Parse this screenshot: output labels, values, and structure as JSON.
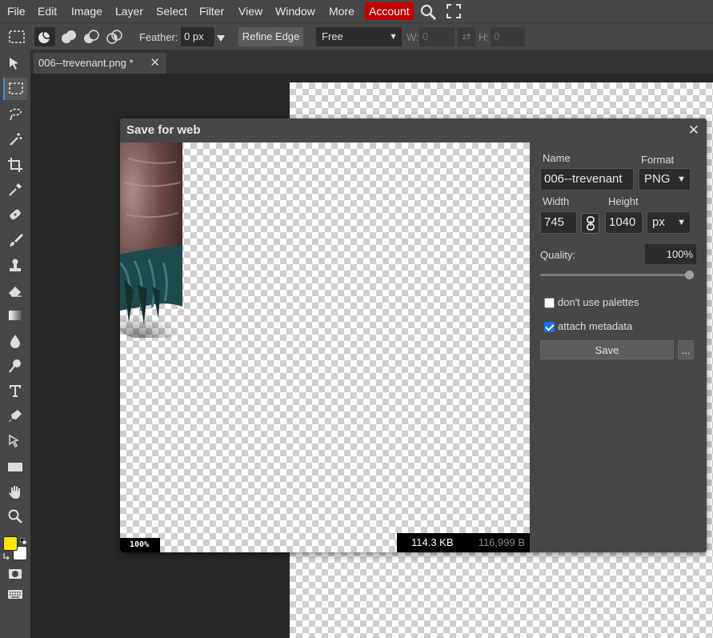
{
  "menubar": {
    "items": [
      "File",
      "Edit",
      "Image",
      "Layer",
      "Select",
      "Filter",
      "View",
      "Window",
      "More"
    ],
    "account": "Account"
  },
  "options": {
    "feather_label": "Feather:",
    "feather_value": "0 px",
    "refine_edge": "Refine Edge",
    "style_value": "Free",
    "w_label": "W:",
    "w_value": "0",
    "h_label": "H:",
    "h_value": "0"
  },
  "document": {
    "tab_title": "006--trevenant.png *"
  },
  "dialog": {
    "title": "Save for web",
    "zoom": "100%",
    "size_kb": "114.3 KB",
    "size_bytes": "116,999 B",
    "name_label": "Name",
    "name_value": "006--trevenant",
    "format_label": "Format",
    "format_value": "PNG",
    "width_label": "Width",
    "width_value": "745",
    "height_label": "Height",
    "height_value": "1040",
    "unit_value": "px",
    "quality_label": "Quality:",
    "quality_value": "100%",
    "quality_fraction": 1.0,
    "no_palettes_label": "don't use palettes",
    "no_palettes_checked": false,
    "metadata_label": "attach metadata",
    "metadata_checked": true,
    "save_label": "Save",
    "more_label": "..."
  },
  "colors": {
    "foreground": "#ffe600",
    "background": "#ffffff",
    "accent": "#c30000"
  }
}
